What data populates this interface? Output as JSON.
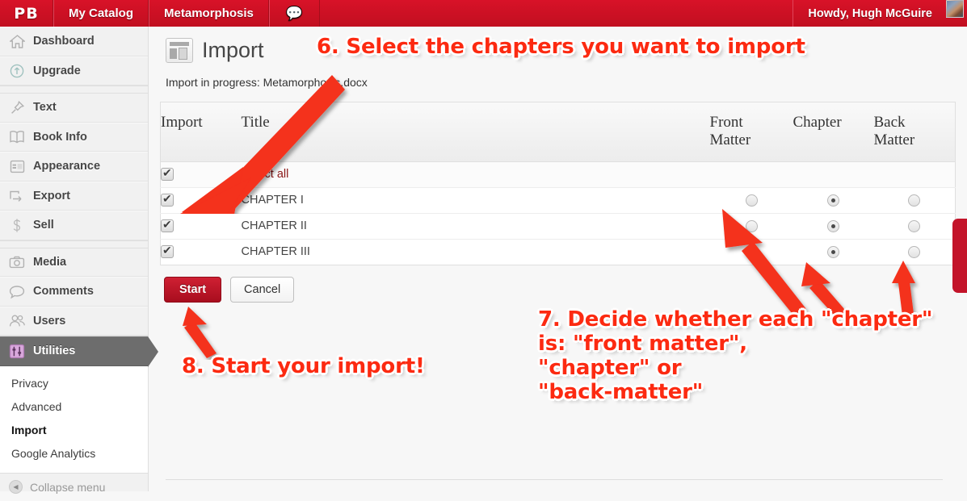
{
  "adminbar": {
    "logo": "PB",
    "items": [
      {
        "label": "My Catalog",
        "name": "my-catalog"
      },
      {
        "label": "Metamorphosis",
        "name": "metamorphosis"
      }
    ],
    "comment_icon": "💬",
    "howdy": "Howdy, Hugh McGuire",
    "bg_color": "#cc1122"
  },
  "sidebar": {
    "items": [
      {
        "label": "Dashboard",
        "icon": "home-icon"
      },
      {
        "label": "Upgrade",
        "icon": "upgrade-arrow-icon"
      },
      {
        "label": "Text",
        "icon": "pushpin-icon"
      },
      {
        "label": "Book Info",
        "icon": "book-icon"
      },
      {
        "label": "Appearance",
        "icon": "layout-icon"
      },
      {
        "label": "Export",
        "icon": "export-arrow-icon"
      },
      {
        "label": "Sell",
        "icon": "dollar-icon"
      },
      {
        "label": "Media",
        "icon": "camera-icon"
      },
      {
        "label": "Comments",
        "icon": "speech-bubble-icon"
      },
      {
        "label": "Users",
        "icon": "users-icon"
      },
      {
        "label": "Utilities",
        "icon": "sliders-icon",
        "active": true
      }
    ],
    "submenu": [
      {
        "label": "Privacy",
        "current": false
      },
      {
        "label": "Advanced",
        "current": false
      },
      {
        "label": "Import",
        "current": true
      },
      {
        "label": "Google Analytics",
        "current": false
      }
    ],
    "collapse_label": "Collapse menu",
    "collapse_icon": "◀",
    "active_bg": "#6d6d6d"
  },
  "page": {
    "title": "Import",
    "icon": "import-page-icon",
    "status": "Import in progress: Metamorphosis.docx"
  },
  "table": {
    "headers": {
      "import": "Import",
      "title": "Title",
      "front_matter": "Front\nMatter",
      "chapter": "Chapter",
      "back_matter": "Back\nMatter"
    },
    "select_all_label": "Select all",
    "select_all_checked": true,
    "rows": [
      {
        "title": "CHAPTER I",
        "checked": true,
        "type": "chapter"
      },
      {
        "title": "CHAPTER II",
        "checked": true,
        "type": "chapter"
      },
      {
        "title": "CHAPTER III",
        "checked": true,
        "type": "chapter"
      }
    ]
  },
  "buttons": {
    "start": "Start",
    "cancel": "Cancel",
    "start_color": "#b81124"
  },
  "annotations": {
    "a6": "6. Select the chapters you want to import",
    "a7": "7. Decide whether each \"chapter\"\nis: \"front matter\",\n\"chapter\" or\n\"back-matter\"",
    "a8": "8. Start your import!",
    "color": "#fc2a11"
  }
}
